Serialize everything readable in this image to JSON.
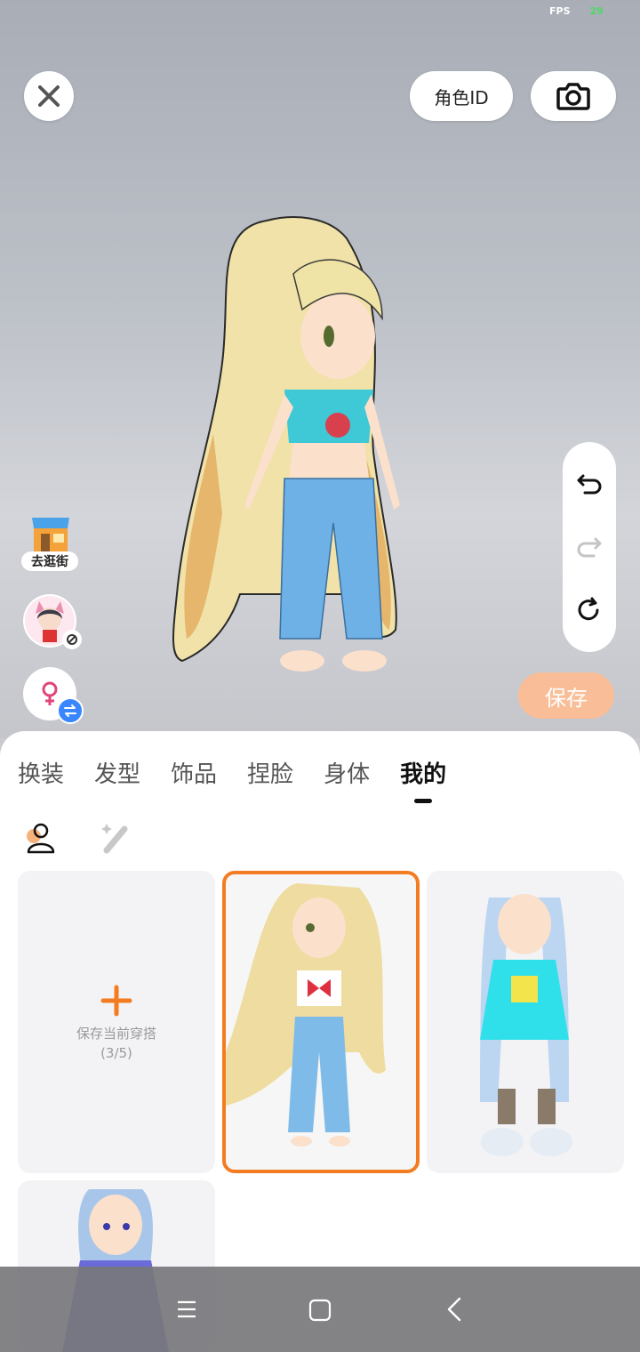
{
  "status": {
    "fps_label": "FPS",
    "fps_value": "29"
  },
  "top_bar": {
    "role_id_label": "角色ID"
  },
  "left_tools": {
    "shop_label": "去逛街"
  },
  "save_button": "保存",
  "tabs": [
    {
      "label": "换装",
      "active": false
    },
    {
      "label": "发型",
      "active": false
    },
    {
      "label": "饰品",
      "active": false
    },
    {
      "label": "捏脸",
      "active": false
    },
    {
      "label": "身体",
      "active": false
    },
    {
      "label": "我的",
      "active": true
    }
  ],
  "outfits": {
    "save_card_title": "保存当前穿搭",
    "save_card_count": "(3/5)"
  },
  "colors": {
    "accent": "#f47c20",
    "save_bg": "#f9be97",
    "swap_badge": "#3a86ff"
  }
}
